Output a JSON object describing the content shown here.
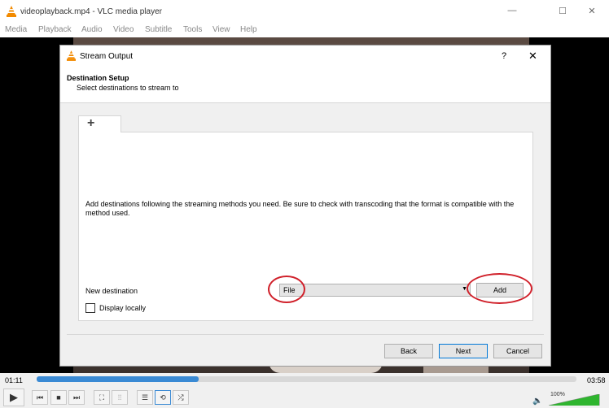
{
  "window": {
    "title": "videoplayback.mp4 - VLC media player",
    "minimize": "—",
    "maximize": "☐",
    "close": "✕"
  },
  "menu": [
    "Media",
    "Playback",
    "Audio",
    "Video",
    "Subtitle",
    "Tools",
    "View",
    "Help"
  ],
  "dialog": {
    "title": "Stream Output",
    "help": "?",
    "close": "✕",
    "header_title": "Destination Setup",
    "header_subtitle": "Select destinations to stream to",
    "tab_label": "+",
    "description": "Add destinations following the streaming methods you need. Be sure to check with transcoding that the format is compatible with the method used.",
    "new_destination_label": "New destination",
    "destination_value": "File",
    "add_label": "Add",
    "display_locally_label": "Display locally",
    "display_locally_checked": false,
    "back_label": "Back",
    "next_label": "Next",
    "cancel_label": "Cancel"
  },
  "player": {
    "elapsed": "01:11",
    "total": "03:58",
    "progress": 0.3,
    "volume": "100%",
    "volume_level": 1.0
  },
  "colors": {
    "accent": "#0078d7",
    "annotation": "#d0202a",
    "seek_fill": "#3a8ad4",
    "vlc_orange": "#f28a00"
  }
}
